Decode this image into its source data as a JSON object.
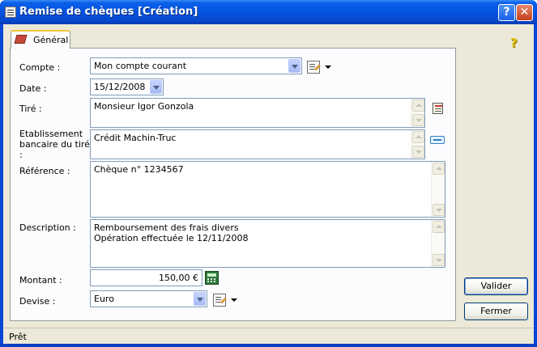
{
  "window": {
    "title": "Remise de chèques [Création]",
    "help_button": "?",
    "close_button": "✕"
  },
  "tabs": [
    {
      "label": "Général"
    }
  ],
  "form": {
    "compte": {
      "label": "Compte :",
      "value": "Mon compte courant"
    },
    "date": {
      "label": "Date :",
      "value": "15/12/2008"
    },
    "tire": {
      "label": "Tiré :",
      "value": "Monsieur Igor Gonzola"
    },
    "etablissement": {
      "label_line1": "Etablissement",
      "label_line2": "bancaire du tiré",
      "label_line3": ":",
      "value": "Crédit Machin-Truc"
    },
    "reference": {
      "label": "Référence :",
      "value": "Chèque n° 1234567"
    },
    "description": {
      "label": "Description :",
      "value": "Remboursement des frais divers\nOpération effectuée le 12/11/2008"
    },
    "montant": {
      "label": "Montant :",
      "value": "150,00 €"
    },
    "devise": {
      "label": "Devise :",
      "value": "Euro"
    }
  },
  "buttons": {
    "valider": "Valider",
    "fermer": "Fermer"
  },
  "help_icon": "?",
  "status": {
    "text": "Prêt"
  },
  "colors": {
    "titlebar": "#0453e0",
    "client": "#ece9d8",
    "panel": "#fcfcfe"
  }
}
